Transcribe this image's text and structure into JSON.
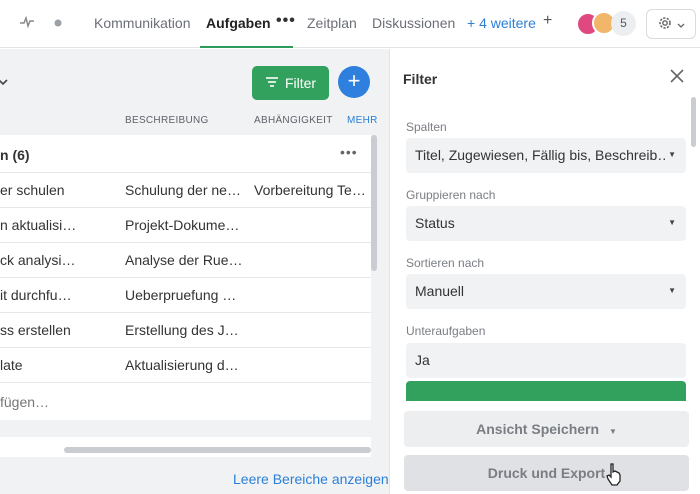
{
  "topbar": {
    "tabs": {
      "kommunikation": "Kommunikation",
      "aufgaben": "Aufgaben",
      "aufgaben_more": "•••",
      "zeitplan": "Zeitplan",
      "diskussionen": "Diskussionen",
      "weitere": "+ 4 weitere"
    },
    "add_symbol": "+",
    "member_count": "5"
  },
  "board": {
    "filter_label": "Filter",
    "add_symbol": "+",
    "columns": {
      "beschreibung": "BESCHREIBUNG",
      "abhaengigkeit": "ABHÄNGIGKEIT",
      "mehr": "MEHR"
    },
    "group_title": "n (6)",
    "group_menu": "•••",
    "rows": [
      {
        "title": "er schulen",
        "beschreibung": "Schulung der ne…",
        "abhaengigkeit": "Vorbereitung Te…"
      },
      {
        "title": "n aktualisi…",
        "beschreibung": "Projekt-Dokume…",
        "abhaengigkeit": ""
      },
      {
        "title": "ck analysi…",
        "beschreibung": "Analyse der Rue…",
        "abhaengigkeit": ""
      },
      {
        "title": "it durchfu…",
        "beschreibung": "Ueberpruefung …",
        "abhaengigkeit": ""
      },
      {
        "title": "ss erstellen",
        "beschreibung": "Erstellung des J…",
        "abhaengigkeit": ""
      },
      {
        "title": "late",
        "beschreibung": "Aktualisierung d…",
        "abhaengigkeit": ""
      }
    ],
    "add_task": "fügen…",
    "show_empty": "Leere Bereiche anzeigen"
  },
  "filter_panel": {
    "title": "Filter",
    "sections": [
      {
        "label": "Spalten",
        "value": "Titel, Zugewiesen, Fällig bis, Beschreib…"
      },
      {
        "label": "Gruppieren nach",
        "value": "Status"
      },
      {
        "label": "Sortieren nach",
        "value": "Manuell"
      },
      {
        "label": "Unteraufgaben",
        "value": "Ja"
      }
    ],
    "save_view": "Ansicht Speichern",
    "print_export": "Druck und Export"
  },
  "colors": {
    "accent_green": "#32a15e",
    "accent_blue": "#2f7fde",
    "link_blue": "#2b7fd6"
  }
}
